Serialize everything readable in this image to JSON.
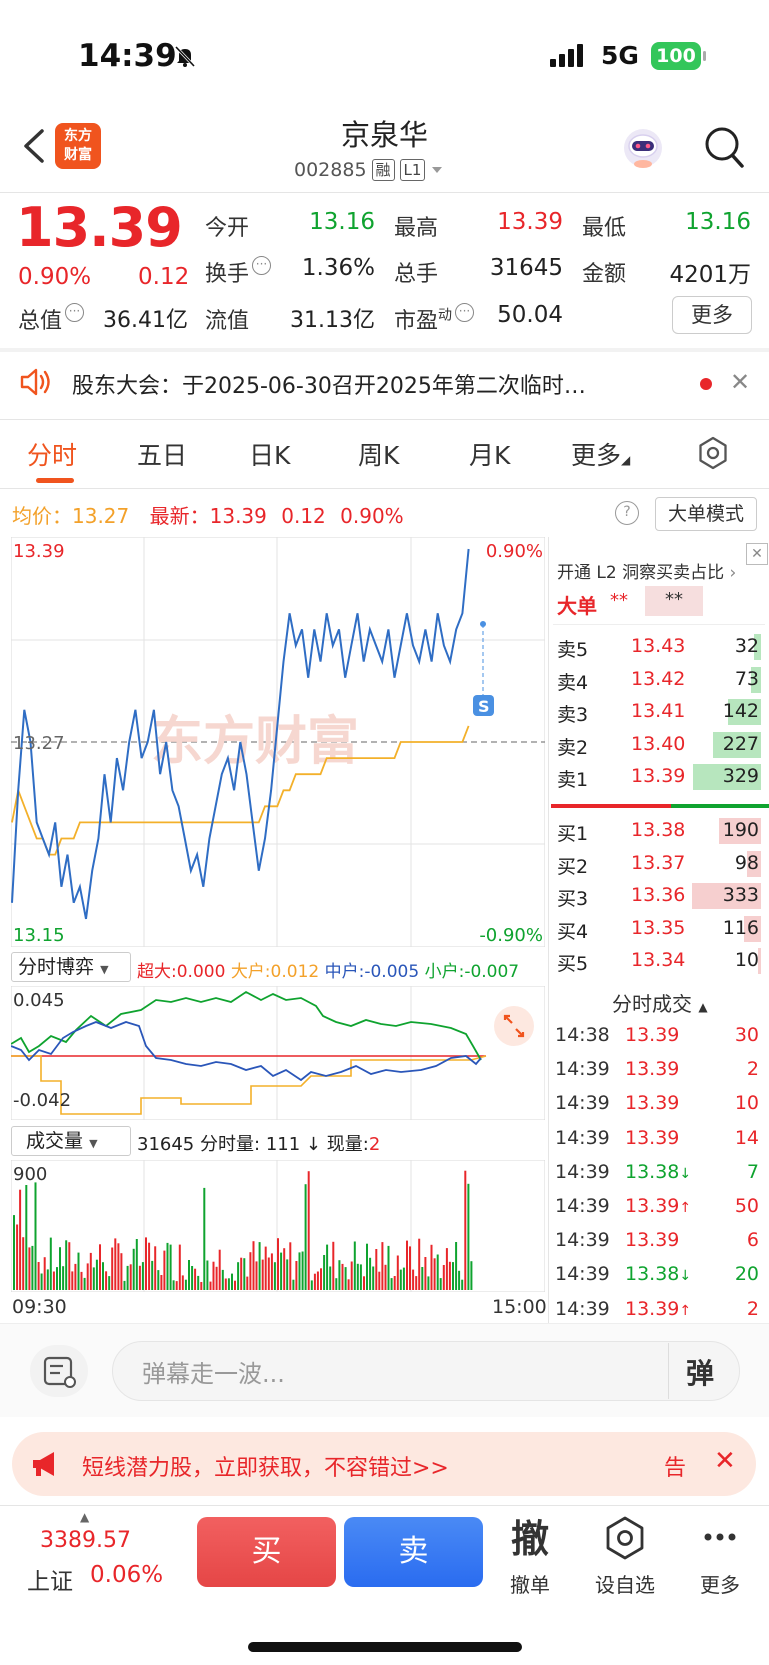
{
  "status_bar": {
    "time": "14:39",
    "network": "5G",
    "battery": "100"
  },
  "header": {
    "logo_text_line1": "东方",
    "logo_text_line2": "财富",
    "stock_name": "京泉华",
    "stock_code": "002885",
    "tag_margin": "融",
    "tag_level": "L1"
  },
  "quote": {
    "price": "13.39",
    "change_pct": "0.90%",
    "change": "0.12",
    "fields": {
      "open_label": "今开",
      "open": "13.16",
      "high_label": "最高",
      "high": "13.39",
      "low_label": "最低",
      "low": "13.16",
      "turnover_label": "换手",
      "turnover": "1.36%",
      "volume_label": "总手",
      "volume": "31645",
      "amount_label": "金额",
      "amount": "4201万",
      "mktcap_label": "总值",
      "mktcap": "36.41亿",
      "float_label": "流值",
      "float": "31.13亿",
      "pe_label": "市盈",
      "pe_sup": "动",
      "pe": "50.04"
    },
    "more_button": "更多"
  },
  "notice": {
    "text": "股东大会：于2025-06-30召开2025年第二次临时…"
  },
  "tabs": [
    {
      "label": "分时"
    },
    {
      "label": "五日"
    },
    {
      "label": "日K"
    },
    {
      "label": "周K"
    },
    {
      "label": "月K"
    },
    {
      "label": "更多"
    }
  ],
  "chart_header": {
    "avg_label": "均价：",
    "avg_value": "13.27",
    "latest_label": "最新：",
    "latest_value": "13.39",
    "latest_change": "0.12",
    "latest_pct": "0.90%",
    "big_order_button": "大单模式"
  },
  "chart_data": {
    "type": "line",
    "title": "",
    "y_top": "13.39",
    "y_mid": "13.27",
    "y_bottom": "13.15",
    "pct_top": "0.90%",
    "pct_bottom": "-0.90%",
    "watermark": "东方财富",
    "marker": "S",
    "x_start": "09:30",
    "x_end": "15:00",
    "ylim": [
      13.15,
      13.39
    ],
    "series": [
      {
        "name": "",
        "color": "#2f6dc4",
        "values": [
          13.17,
          13.24,
          13.29,
          13.27,
          13.22,
          13.21,
          13.2,
          13.22,
          13.18,
          13.2,
          13.17,
          13.18,
          13.16,
          13.19,
          13.21,
          13.25,
          13.22,
          13.26,
          13.24,
          13.27,
          13.29,
          13.26,
          13.27,
          13.29,
          13.25,
          13.27,
          13.24,
          13.23,
          13.21,
          13.19,
          13.2,
          13.18,
          13.21,
          13.23,
          13.25,
          13.26,
          13.24,
          13.27,
          13.25,
          13.22,
          13.19,
          13.21,
          13.24,
          13.28,
          13.32,
          13.35,
          13.33,
          13.34,
          13.31,
          13.34,
          13.32,
          13.35,
          13.33,
          13.34,
          13.31,
          13.33,
          13.35,
          13.32,
          13.34,
          13.33,
          13.32,
          13.34,
          13.31,
          13.33,
          13.35,
          13.33,
          13.32,
          13.34,
          13.32,
          13.35,
          13.33,
          13.32,
          13.34,
          13.35,
          13.39
        ]
      },
      {
        "name": "",
        "color": "#f3b02a",
        "values": [
          13.22,
          13.24,
          13.23,
          13.22,
          13.21,
          13.21,
          13.2,
          13.2,
          13.21,
          13.21,
          13.21,
          13.22,
          13.22,
          13.22,
          13.22,
          13.22,
          13.22,
          13.22,
          13.22,
          13.22,
          13.22,
          13.22,
          13.22,
          13.22,
          13.22,
          13.22,
          13.22,
          13.22,
          13.22,
          13.22,
          13.22,
          13.22,
          13.22,
          13.22,
          13.22,
          13.22,
          13.22,
          13.22,
          13.22,
          13.22,
          13.22,
          13.23,
          13.23,
          13.23,
          13.24,
          13.24,
          13.25,
          13.25,
          13.25,
          13.25,
          13.25,
          13.26,
          13.26,
          13.26,
          13.26,
          13.26,
          13.26,
          13.26,
          13.26,
          13.26,
          13.26,
          13.26,
          13.26,
          13.27,
          13.27,
          13.27,
          13.27,
          13.27,
          13.27,
          13.27,
          13.27,
          13.27,
          13.27,
          13.27,
          13.28
        ]
      }
    ]
  },
  "game_panel": {
    "title": "分时博弈",
    "super_label": "超大:",
    "super_value": "0.000",
    "large_label": "大户:",
    "large_value": "0.012",
    "mid_label": "中户:",
    "mid_value": "-0.005",
    "small_label": "小户:",
    "small_value": "-0.007",
    "y_top": "0.045",
    "y_bottom": "-0.042"
  },
  "volume_panel": {
    "title": "成交量",
    "total": "31645",
    "minute_label": "分时量:",
    "minute_value": "111",
    "arrow": "↓",
    "now_label": "现量:",
    "now_value": "2",
    "y_top": "900"
  },
  "order_book": {
    "l2_text": "开通 L2 洞察买卖占比",
    "big_label": "大单",
    "big_red": "**",
    "big_green": "**",
    "asks": [
      {
        "label": "卖5",
        "price": "13.43",
        "vol": "32",
        "ratio": 0.05
      },
      {
        "label": "卖4",
        "price": "13.42",
        "vol": "73",
        "ratio": 0.08
      },
      {
        "label": "卖3",
        "price": "13.41",
        "vol": "142",
        "ratio": 0.25
      },
      {
        "label": "卖2",
        "price": "13.40",
        "vol": "227",
        "ratio": 0.37
      },
      {
        "label": "卖1",
        "price": "13.39",
        "vol": "329",
        "ratio": 0.52
      }
    ],
    "bids": [
      {
        "label": "买1",
        "price": "13.38",
        "vol": "190",
        "ratio": 0.32
      },
      {
        "label": "买2",
        "price": "13.37",
        "vol": "98",
        "ratio": 0.11
      },
      {
        "label": "买3",
        "price": "13.36",
        "vol": "333",
        "ratio": 0.53
      },
      {
        "label": "买4",
        "price": "13.35",
        "vol": "116",
        "ratio": 0.13
      },
      {
        "label": "买5",
        "price": "13.34",
        "vol": "10",
        "ratio": 0.02
      }
    ],
    "trades_title": "分时成交",
    "trades": [
      {
        "time": "14:38",
        "price": "13.39",
        "arrow": "",
        "vol": "30",
        "vol_color": "#e8262a"
      },
      {
        "time": "14:39",
        "price": "13.39",
        "arrow": "",
        "vol": "2",
        "vol_color": "#e8262a"
      },
      {
        "time": "14:39",
        "price": "13.39",
        "arrow": "",
        "vol": "10",
        "vol_color": "#e8262a"
      },
      {
        "time": "14:39",
        "price": "13.39",
        "arrow": "",
        "vol": "14",
        "vol_color": "#e8262a"
      },
      {
        "time": "14:39",
        "price": "13.38",
        "arrow": "↓",
        "vol": "7",
        "vol_color": "#0fa32f"
      },
      {
        "time": "14:39",
        "price": "13.39",
        "arrow": "↑",
        "vol": "50",
        "vol_color": "#e8262a"
      },
      {
        "time": "14:39",
        "price": "13.39",
        "arrow": "",
        "vol": "6",
        "vol_color": "#e8262a"
      },
      {
        "time": "14:39",
        "price": "13.38",
        "arrow": "↓",
        "vol": "20",
        "vol_color": "#0fa32f"
      },
      {
        "time": "14:39",
        "price": "13.39",
        "arrow": "↑",
        "vol": "2",
        "vol_color": "#e8262a"
      }
    ]
  },
  "danmu": {
    "placeholder": "弹幕走一波...",
    "button": "弹"
  },
  "ad": {
    "text": "短线潜力股，立即获取，不容错过>>",
    "tail": "告"
  },
  "bottom_bar": {
    "index_value": "3389.57",
    "index_name": "上证",
    "index_pct": "0.06%",
    "buy": "买",
    "sell": "卖",
    "cancel_icon": "撤",
    "cancel": "撤单",
    "watch": "设自选",
    "more": "更多"
  },
  "colors": {
    "red": "#e8262a",
    "green": "#0fa32f",
    "price_line": "#2f6dc4",
    "avg_line": "#f3b02a",
    "brand": "#f0541e"
  }
}
